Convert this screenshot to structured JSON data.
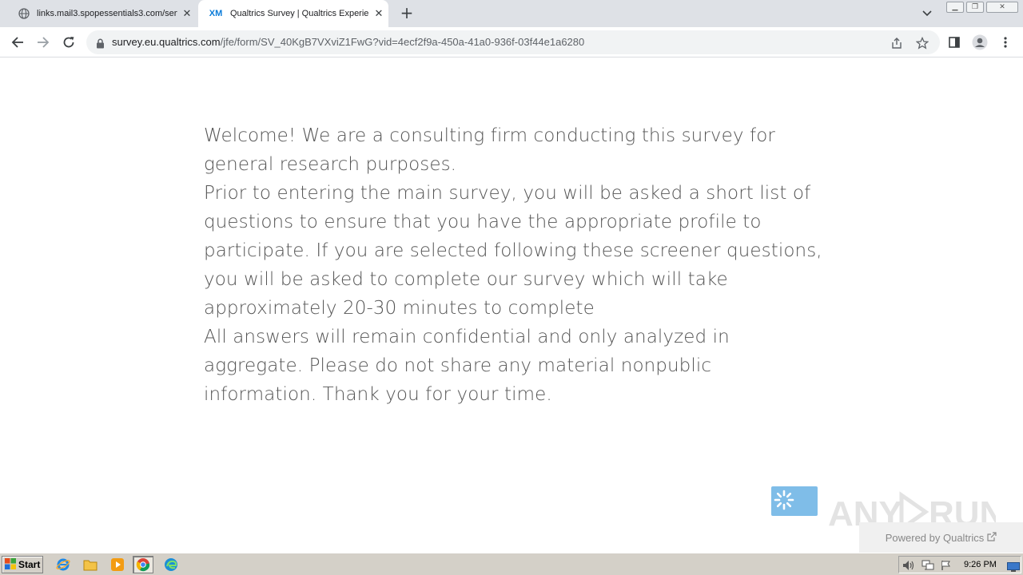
{
  "browser": {
    "tabs": [
      {
        "title": "links.mail3.spopessentials3.com/serv",
        "active": false
      },
      {
        "title": "Qualtrics Survey | Qualtrics Experien",
        "active": true,
        "favicon_text": "XM"
      }
    ],
    "url_host": "survey.eu.qualtrics.com",
    "url_path": "/jfe/form/SV_40KgB7VXviZ1FwG?vid=4ecf2f9a-450a-41a0-936f-03f44e1a6280"
  },
  "survey": {
    "paragraphs": [
      "Welcome! We are a consulting firm conducting this survey for general research purposes.",
      "Prior to entering the main survey, you will be asked a short list of questions to ensure that you have the appropriate profile to participate. If you are selected following these screener questions, you will be asked to complete our survey which will take approximately 20-30 minutes to complete",
      "All answers will remain confidential and only analyzed in aggregate. Please do not share any material nonpublic information. Thank you for your time."
    ],
    "powered_by": "Powered by Qualtrics",
    "watermark": "ANY RUN"
  },
  "taskbar": {
    "start_label": "Start",
    "clock": "9:26 PM"
  },
  "colors": {
    "next_button": "#7fbde8",
    "text": "#555555",
    "qualtrics_xm": "#0a7bd8"
  }
}
